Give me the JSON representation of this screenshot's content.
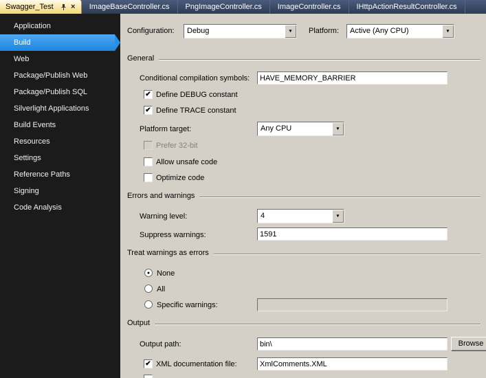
{
  "tabbar": {
    "active_tab": {
      "label": "Swagger_Test"
    },
    "tabs": [
      {
        "label": "ImageBaseController.cs"
      },
      {
        "label": "PngImageController.cs"
      },
      {
        "label": "ImageController.cs"
      },
      {
        "label": "IHttpActionResultController.cs"
      }
    ]
  },
  "icons": {
    "dropdown_arrow": "▼",
    "close": "×",
    "check": "✔",
    "radio_dot": "●"
  },
  "sidebar": {
    "items": [
      {
        "label": "Application"
      },
      {
        "label": "Build"
      },
      {
        "label": "Web"
      },
      {
        "label": "Package/Publish Web"
      },
      {
        "label": "Package/Publish SQL"
      },
      {
        "label": "Silverlight Applications"
      },
      {
        "label": "Build Events"
      },
      {
        "label": "Resources"
      },
      {
        "label": "Settings"
      },
      {
        "label": "Reference Paths"
      },
      {
        "label": "Signing"
      },
      {
        "label": "Code Analysis"
      }
    ]
  },
  "toolbar": {
    "configuration_label": "Configuration:",
    "configuration_value": "Debug",
    "platform_label": "Platform:",
    "platform_value": "Active (Any CPU)"
  },
  "sections": {
    "general": {
      "title": "General"
    },
    "errors": {
      "title": "Errors and warnings"
    },
    "treat": {
      "title": "Treat warnings as errors"
    },
    "output": {
      "title": "Output"
    }
  },
  "fields": {
    "conditional_symbols": {
      "label": "Conditional compilation symbols:",
      "value": "HAVE_MEMORY_BARRIER"
    },
    "define_debug": {
      "label": "Define DEBUG constant",
      "glyph": "✔"
    },
    "define_trace": {
      "label": "Define TRACE constant",
      "glyph": "✔"
    },
    "platform_target": {
      "label": "Platform target:",
      "value": "Any CPU"
    },
    "prefer_32bit": {
      "label": "Prefer 32-bit",
      "glyph": ""
    },
    "allow_unsafe": {
      "label": "Allow unsafe code",
      "glyph": ""
    },
    "optimize": {
      "label": "Optimize code",
      "glyph": ""
    },
    "warning_level": {
      "label": "Warning level:",
      "value": "4"
    },
    "suppress_warnings": {
      "label": "Suppress warnings:",
      "value": "1591"
    },
    "radio_none": {
      "label": "None",
      "glyph": "●"
    },
    "radio_all": {
      "label": "All",
      "glyph": ""
    },
    "radio_specific": {
      "label": "Specific warnings:",
      "value": "",
      "glyph": ""
    },
    "output_path": {
      "label": "Output path:",
      "value": "bin\\",
      "browse_label": "Browse"
    },
    "xml_doc": {
      "label": "XML documentation file:",
      "value": "XmlComments.XML",
      "glyph": "✔"
    },
    "partial_checkbox": {
      "glyph": ""
    }
  }
}
